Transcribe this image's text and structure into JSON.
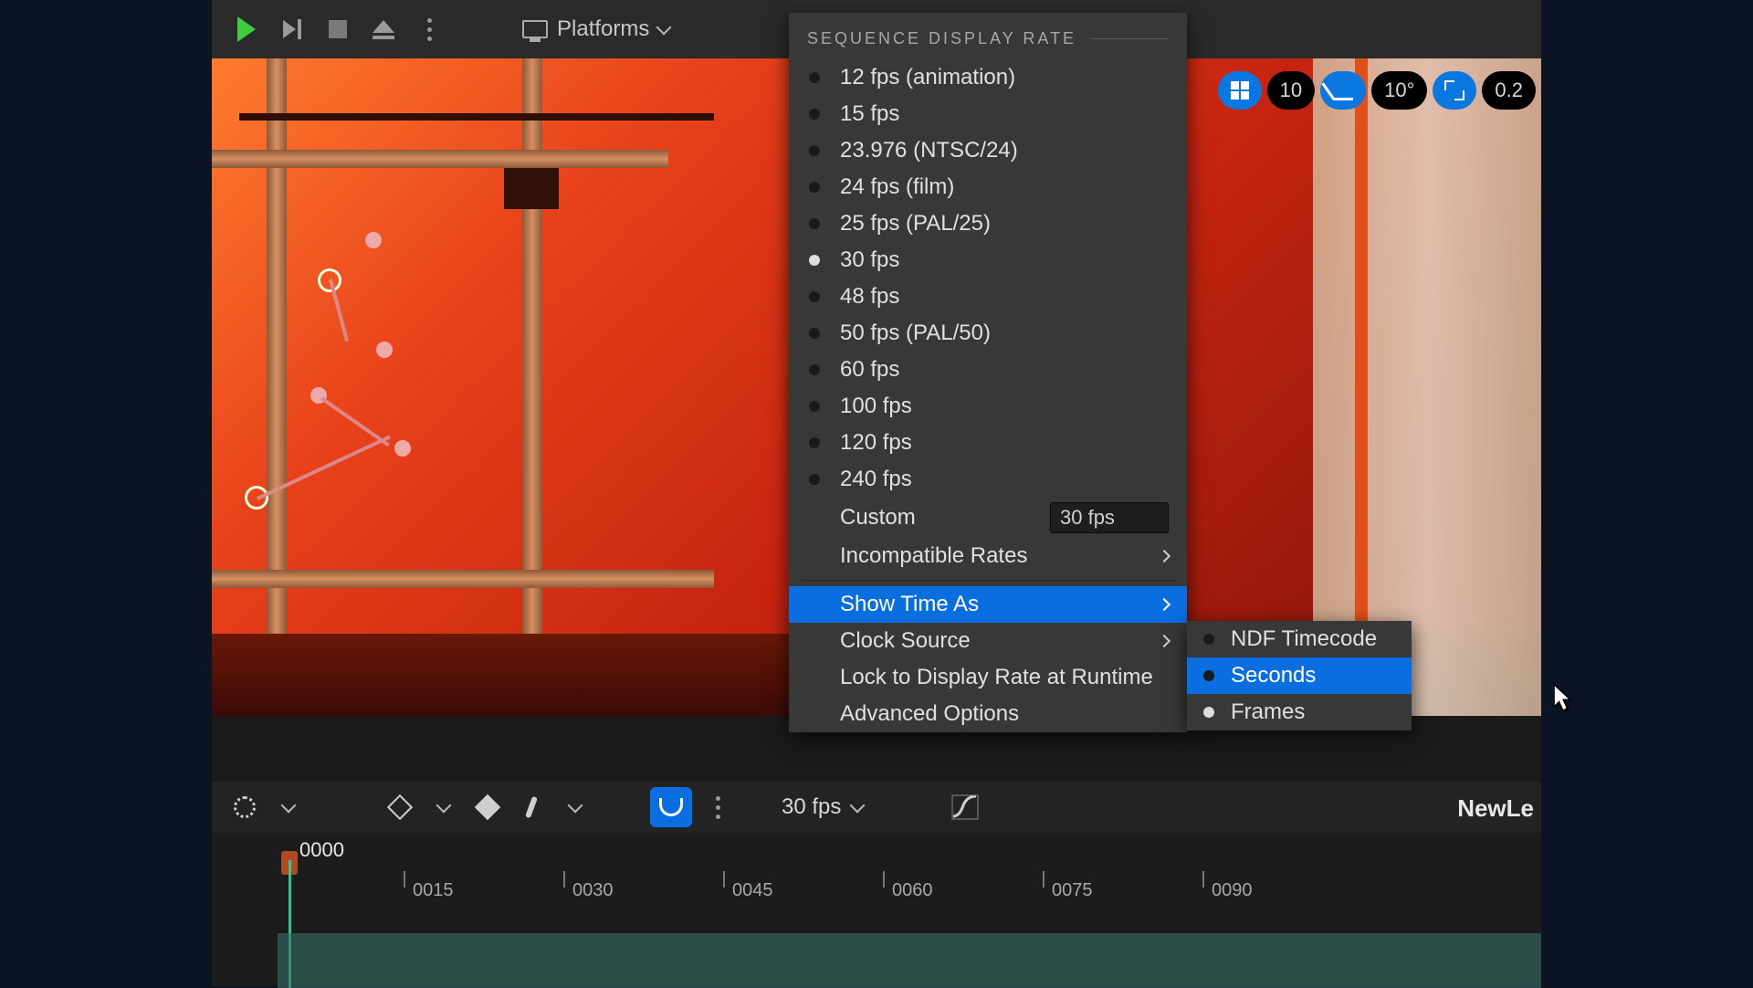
{
  "toolbar": {
    "platforms_label": "Platforms"
  },
  "viewport_tools": {
    "grid_value": "10",
    "angle_value": "10°",
    "scale_value": "0.2"
  },
  "dropdown": {
    "header": "SEQUENCE DISPLAY RATE",
    "rates": [
      {
        "label": "12 fps (animation)",
        "selected": false
      },
      {
        "label": "15 fps",
        "selected": false
      },
      {
        "label": "23.976 (NTSC/24)",
        "selected": false
      },
      {
        "label": "24 fps (film)",
        "selected": false
      },
      {
        "label": "25 fps (PAL/25)",
        "selected": false
      },
      {
        "label": "30 fps",
        "selected": true
      },
      {
        "label": "48 fps",
        "selected": false
      },
      {
        "label": "50 fps (PAL/50)",
        "selected": false
      },
      {
        "label": "60 fps",
        "selected": false
      },
      {
        "label": "100 fps",
        "selected": false
      },
      {
        "label": "120 fps",
        "selected": false
      },
      {
        "label": "240 fps",
        "selected": false
      }
    ],
    "custom_label": "Custom",
    "custom_value": "30 fps",
    "incompatible_label": "Incompatible Rates",
    "show_time_label": "Show Time As",
    "clock_source_label": "Clock Source",
    "lock_label": "Lock to Display Rate at Runtime",
    "advanced_label": "Advanced Options"
  },
  "submenu": {
    "items": [
      {
        "label": "NDF Timecode",
        "selected": false,
        "highlight": false
      },
      {
        "label": "Seconds",
        "selected": false,
        "highlight": true
      },
      {
        "label": "Frames",
        "selected": true,
        "highlight": false
      }
    ]
  },
  "seq_toolbar": {
    "fps_label": "30 fps",
    "sequence_name": "NewLe"
  },
  "timeline": {
    "playhead": "0000",
    "ticks": [
      "0015",
      "0030",
      "0045",
      "0060",
      "0075",
      "0090"
    ]
  },
  "colors": {
    "highlight": "#0a6de0",
    "play": "#3fcc3f"
  }
}
